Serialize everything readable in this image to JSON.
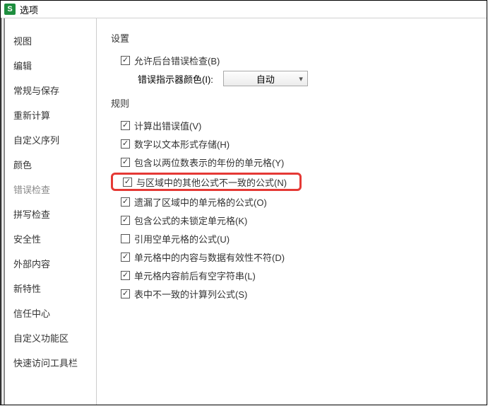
{
  "titlebar": {
    "appGlyph": "S",
    "title": "选项"
  },
  "sidebar": {
    "items": [
      {
        "label": "视图"
      },
      {
        "label": "编辑"
      },
      {
        "label": "常规与保存"
      },
      {
        "label": "重新计算"
      },
      {
        "label": "自定义序列"
      },
      {
        "label": "颜色"
      },
      {
        "label": "错误检查",
        "selected": true
      },
      {
        "label": "拼写检查"
      },
      {
        "label": "安全性"
      },
      {
        "label": "外部内容"
      },
      {
        "label": "新特性"
      },
      {
        "label": "信任中心"
      },
      {
        "label": "自定义功能区"
      },
      {
        "label": "快速访问工具栏"
      }
    ]
  },
  "main": {
    "settings": {
      "title": "设置",
      "bg_check": {
        "label": "允许后台错误检查(B)",
        "checked": true
      },
      "colorRow": {
        "label": "错误指示器颜色(I):",
        "value": "自动"
      }
    },
    "rules": {
      "title": "规则",
      "items": [
        {
          "label": "计算出错误值(V)",
          "checked": true
        },
        {
          "label": "数字以文本形式存储(H)",
          "checked": true
        },
        {
          "label": "包含以两位数表示的年份的单元格(Y)",
          "checked": true
        },
        {
          "label": "与区域中的其他公式不一致的公式(N)",
          "checked": true,
          "highlight": true
        },
        {
          "label": "遗漏了区域中的单元格的公式(O)",
          "checked": true
        },
        {
          "label": "包含公式的未锁定单元格(K)",
          "checked": true
        },
        {
          "label": "引用空单元格的公式(U)",
          "checked": false
        },
        {
          "label": "单元格中的内容与数据有效性不符(D)",
          "checked": true
        },
        {
          "label": "单元格内容前后有空字符串(L)",
          "checked": true
        },
        {
          "label": "表中不一致的计算列公式(S)",
          "checked": true
        }
      ]
    }
  }
}
